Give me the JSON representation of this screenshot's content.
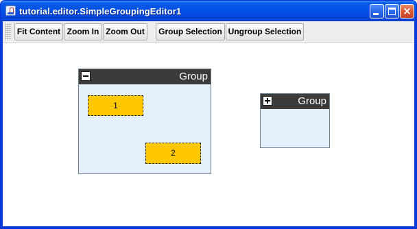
{
  "window": {
    "title": "tutorial.editor.SimpleGroupingEditor1",
    "controls": {
      "minimize": "minimize",
      "maximize": "maximize",
      "close": "×"
    }
  },
  "toolbar": {
    "buttons": [
      {
        "label": "Fit Content"
      },
      {
        "label": "Zoom In"
      },
      {
        "label": "Zoom Out"
      },
      {
        "label": "Group Selection"
      },
      {
        "label": "Ungroup Selection"
      }
    ]
  },
  "graph": {
    "groups": [
      {
        "title": "Group",
        "state": "expanded",
        "nodes": [
          {
            "label": "1"
          },
          {
            "label": "2"
          }
        ]
      },
      {
        "title": "Group",
        "state": "collapsed",
        "nodes": []
      }
    ]
  },
  "colors": {
    "titlebar": "#0052e6",
    "group_header": "#3b3b3b",
    "group_body": "#e4f1fc",
    "node_fill": "#ffc800"
  }
}
